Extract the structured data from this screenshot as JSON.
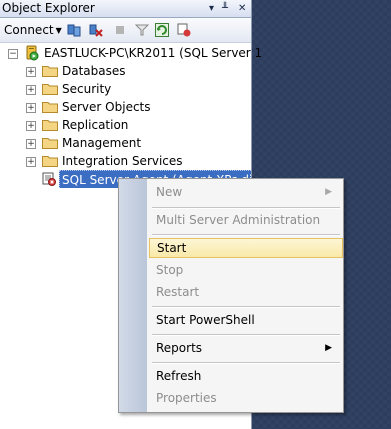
{
  "window": {
    "title": "Object Explorer",
    "pin_glyph": "▾ ╨ ✕"
  },
  "toolbar": {
    "connect_label": "Connect",
    "icons": [
      "connect-db-icon",
      "disconnect-icon",
      "stop-icon",
      "filter-icon",
      "refresh-icon",
      "schema-icon"
    ]
  },
  "tree": {
    "server": "EASTLUCK-PC\\KR2011 (SQL Server 1",
    "items": [
      {
        "label": "Databases"
      },
      {
        "label": "Security"
      },
      {
        "label": "Server Objects"
      },
      {
        "label": "Replication"
      },
      {
        "label": "Management"
      },
      {
        "label": "Integration Services"
      }
    ],
    "agent": "SQL Server Agent (Agent XPs disa"
  },
  "menu": {
    "items": [
      {
        "label": "New",
        "disabled": true,
        "submenu": true
      },
      {
        "label": "Multi Server Administration",
        "disabled": true
      },
      {
        "label": "Start",
        "highlighted": true
      },
      {
        "label": "Stop",
        "disabled": true
      },
      {
        "label": "Restart",
        "disabled": true
      },
      {
        "label": "Start PowerShell"
      },
      {
        "label": "Reports",
        "submenu": true
      },
      {
        "label": "Refresh"
      },
      {
        "label": "Properties",
        "disabled": true
      }
    ]
  },
  "colors": {
    "selection": "#3b6ec3",
    "highlight": "#f9e9a7",
    "background": "#2c3d5e"
  }
}
